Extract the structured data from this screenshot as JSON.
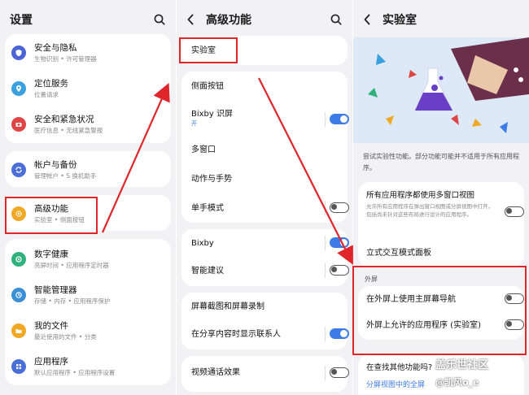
{
  "colors": {
    "accent": "#3d7be8",
    "red": "#e0262b",
    "privacy": "#4a63d6",
    "location": "#3aa0e0",
    "safety": "#e04545",
    "account": "#4a6fd6",
    "advanced": "#f0a825",
    "wellbeing": "#2fb27a",
    "device": "#3a8fd6",
    "files": "#f0a825",
    "apps": "#4a6fd6"
  },
  "settings": {
    "title": "设置",
    "search_icon": "search-icon",
    "items": [
      {
        "title": "安全与隐私",
        "sub": "生物识别 • 许可管理器",
        "icon": "shield-icon"
      },
      {
        "title": "定位服务",
        "sub": "位置请求",
        "icon": "location-icon"
      },
      {
        "title": "安全和紧急状况",
        "sub": "医疗信息 • 无线紧急警报",
        "icon": "emergency-icon"
      },
      {
        "title": "帐户与备份",
        "sub": "管理帐户 • S 换机助手",
        "icon": "sync-icon"
      },
      {
        "title": "高级功能",
        "sub": "实验室 • 侧面按钮",
        "icon": "gear-plus-icon"
      },
      {
        "title": "数字健康",
        "sub": "亮屏时间 • 应用程序定时器",
        "icon": "wellbeing-icon"
      },
      {
        "title": "智能管理器",
        "sub": "存储 • 内存 • 应用程序保护",
        "icon": "device-care-icon"
      },
      {
        "title": "我的文件",
        "sub": "最近使用的文件 • 分类",
        "icon": "folder-icon"
      },
      {
        "title": "应用程序",
        "sub": "默认应用程序 • 应用程序设置",
        "icon": "apps-grid-icon"
      }
    ]
  },
  "advanced": {
    "title": "高级功能",
    "lab_label": "实验室",
    "rows": [
      {
        "title": "侧面按钮"
      },
      {
        "title": "Bixby 识屏",
        "sub": "开",
        "toggle": "on"
      },
      {
        "title": "多窗口"
      },
      {
        "title": "动作与手势"
      },
      {
        "title": "单手模式",
        "toggle": "off"
      },
      {
        "title": "Bixby",
        "toggle": "on"
      },
      {
        "title": "智能建议",
        "toggle": "off"
      },
      {
        "title": "屏幕截图和屏幕录制"
      },
      {
        "title": "在分享内容时显示联系人",
        "toggle": "on"
      },
      {
        "title": "视频通话效果",
        "toggle": "off"
      }
    ]
  },
  "lab": {
    "title": "实验室",
    "description": "尝试实验性功能。部分功能可能并不适用于所有应用程序。",
    "multi_window": {
      "title": "所有应用程序都使用多窗口视图",
      "sub": "允许所有应用程序在弹出窗口视图或分屏视图中打开，包括尚未针对这些布局进行设计的应用程序。",
      "toggle": "off"
    },
    "flex_mode": "立式交互模式面板",
    "cover_header": "外屏",
    "cover_items": [
      {
        "title": "在外屏上使用主屏幕导航",
        "toggle": "off"
      },
      {
        "title": "外屏上允许的应用程序 (实验室)",
        "toggle": "off"
      }
    ],
    "looking_for": "在查找其他功能吗?",
    "link": "分屏视图中的全屏"
  },
  "watermark": {
    "line1": "盖乐世社区",
    "line2": "@凯风o_e"
  }
}
